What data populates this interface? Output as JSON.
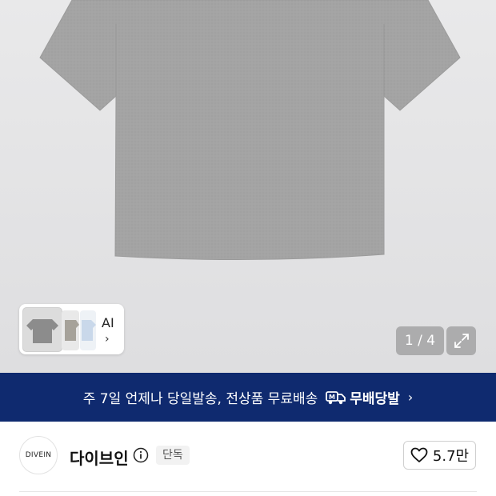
{
  "gallery": {
    "counter": "1 / 4",
    "thumb_label": "AI",
    "thumb_chevron": "›",
    "background_color": "#e4e4e6",
    "shirt_color": "#a3a3a3",
    "icons": {
      "expand": "expand-icon",
      "chevron": "chevron-right-icon"
    }
  },
  "banner": {
    "text": "주 7일 언제나 당일발송, 전상품 무료배송",
    "badge_label": "무배당발",
    "chevron": "›",
    "background_color": "#0f2a6f",
    "icons": {
      "badge": "delivery-truck-icon"
    }
  },
  "seller": {
    "logo_text": "DIVEIN",
    "name": "다이브인",
    "tag": "단독",
    "like_count": "5.7만",
    "icons": {
      "info": "info-icon",
      "like": "heart-icon"
    }
  }
}
